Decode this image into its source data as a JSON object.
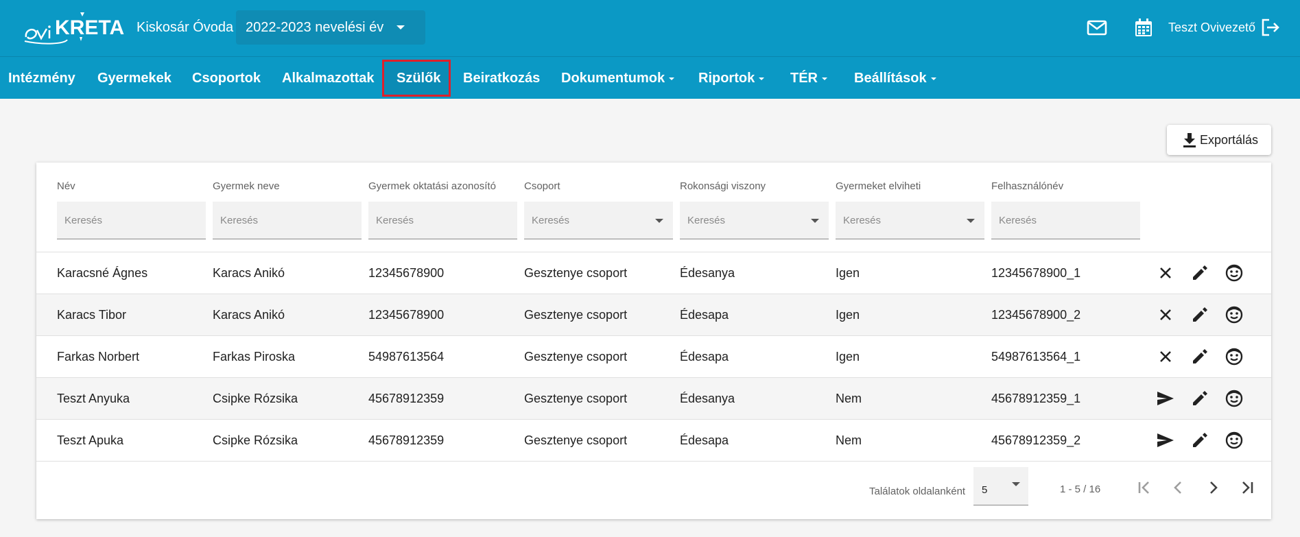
{
  "header": {
    "institution": "Kiskosár Óvoda",
    "school_year": "2022-2023 nevelési év",
    "user": "Teszt Ovivezető",
    "colors": {
      "brand": "#0b99c5",
      "active_border": "#e0202a"
    }
  },
  "nav": {
    "items": [
      {
        "label": "Intézmény"
      },
      {
        "label": "Gyermekek"
      },
      {
        "label": "Csoportok"
      },
      {
        "label": "Alkalmazottak"
      },
      {
        "label": "Szülők",
        "active": true
      },
      {
        "label": "Beiratkozás"
      },
      {
        "label": "Dokumentumok",
        "dropdown": true
      },
      {
        "label": "Riportok",
        "dropdown": true
      },
      {
        "label": "TÉR",
        "dropdown": true
      },
      {
        "label": "Beállítások",
        "dropdown": true
      }
    ]
  },
  "toolbar": {
    "export_label": "Exportálás"
  },
  "table": {
    "columns": [
      "Név",
      "Gyermek neve",
      "Gyermek oktatási azonosító",
      "Csoport",
      "Rokonsági viszony",
      "Gyermeket elviheti",
      "Felhasználónév"
    ],
    "filter_placeholder": "Keresés",
    "rows": [
      {
        "name": "Karacsné Ágnes",
        "child": "Karacs Anikó",
        "child_id": "12345678900",
        "group": "Gesztenye csoport",
        "relation": "Édesanya",
        "can_pick_up": "Igen",
        "username": "12345678900_1",
        "first_action": "close-icon"
      },
      {
        "name": "Karacs Tibor",
        "child": "Karacs Anikó",
        "child_id": "12345678900",
        "group": "Gesztenye csoport",
        "relation": "Édesapa",
        "can_pick_up": "Igen",
        "username": "12345678900_2",
        "first_action": "close-icon"
      },
      {
        "name": "Farkas Norbert",
        "child": "Farkas Piroska",
        "child_id": "54987613564",
        "group": "Gesztenye csoport",
        "relation": "Édesapa",
        "can_pick_up": "Igen",
        "username": "54987613564_1",
        "first_action": "close-icon"
      },
      {
        "name": "Teszt Anyuka",
        "child": "Csipke Rózsika",
        "child_id": "45678912359",
        "group": "Gesztenye csoport",
        "relation": "Édesanya",
        "can_pick_up": "Nem",
        "username": "45678912359_1",
        "first_action": "send-icon"
      },
      {
        "name": "Teszt Apuka",
        "child": "Csipke Rózsika",
        "child_id": "45678912359",
        "group": "Gesztenye csoport",
        "relation": "Édesapa",
        "can_pick_up": "Nem",
        "username": "45678912359_2",
        "first_action": "send-icon"
      }
    ]
  },
  "pagination": {
    "per_page_label": "Találatok oldalanként",
    "per_page_value": "5",
    "range": "1 - 5 / 16"
  }
}
